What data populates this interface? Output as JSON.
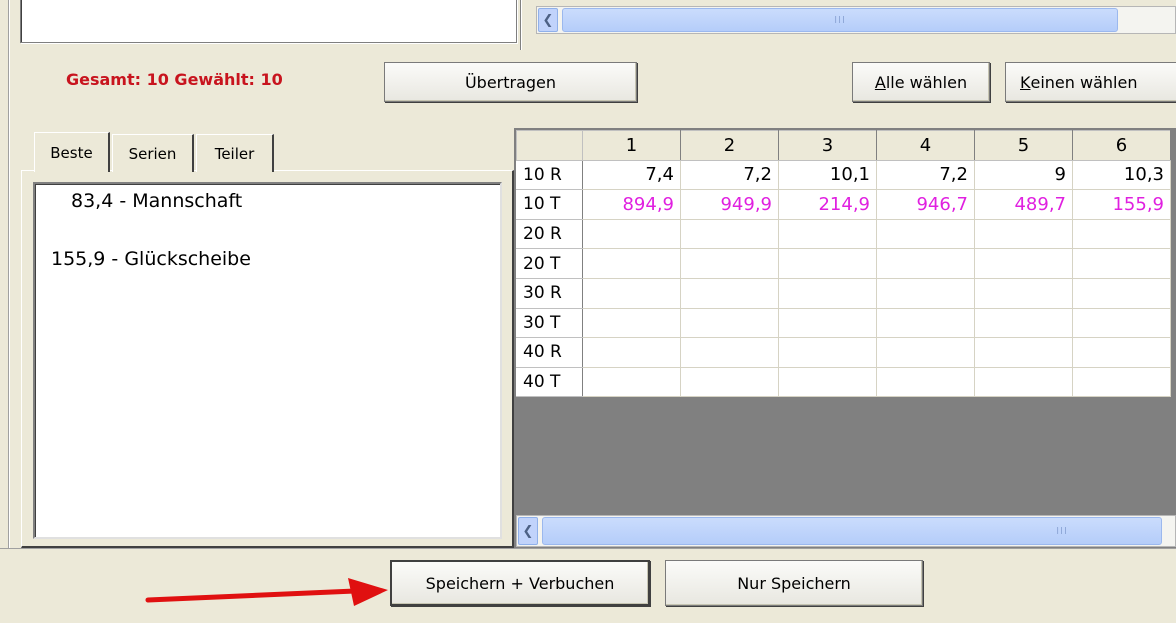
{
  "top": {
    "scroll_grip": "III"
  },
  "selection": {
    "status": "Gesamt: 10 Gewählt: 10",
    "transfer_button": "Übertragen",
    "select_all_prefix": "A",
    "select_all_rest": "lle wählen",
    "select_none_prefix": "K",
    "select_none_rest": "einen wählen"
  },
  "tabs": [
    "Beste",
    "Serien",
    "Teiler"
  ],
  "active_tab": "Beste",
  "best_list": [
    "83,4 - Mannschaft",
    "155,9 - Glückscheibe"
  ],
  "grid": {
    "columns": [
      "1",
      "2",
      "3",
      "4",
      "5",
      "6"
    ],
    "rows": [
      {
        "label": "10 R",
        "values": [
          "7,4",
          "7,2",
          "10,1",
          "7,2",
          "9",
          "10,3"
        ],
        "color": "#000000"
      },
      {
        "label": "10 T",
        "values": [
          "894,9",
          "949,9",
          "214,9",
          "946,7",
          "489,7",
          "155,9"
        ],
        "color": "#e020e0"
      },
      {
        "label": "20 R",
        "values": [
          "",
          "",
          "",
          "",
          "",
          ""
        ]
      },
      {
        "label": "20 T",
        "values": [
          "",
          "",
          "",
          "",
          "",
          ""
        ]
      },
      {
        "label": "30 R",
        "values": [
          "",
          "",
          "",
          "",
          "",
          ""
        ]
      },
      {
        "label": "30 T",
        "values": [
          "",
          "",
          "",
          "",
          "",
          ""
        ]
      },
      {
        "label": "40 R",
        "values": [
          "",
          "",
          "",
          "",
          "",
          ""
        ]
      },
      {
        "label": "40 T",
        "values": [
          "",
          "",
          "",
          "",
          "",
          ""
        ]
      }
    ],
    "scroll_grip": "III"
  },
  "actions": {
    "save_book": "Speichern + Verbuchen",
    "save_only": "Nur Speichern"
  },
  "annotation": {
    "arrow_color": "#e01010"
  }
}
